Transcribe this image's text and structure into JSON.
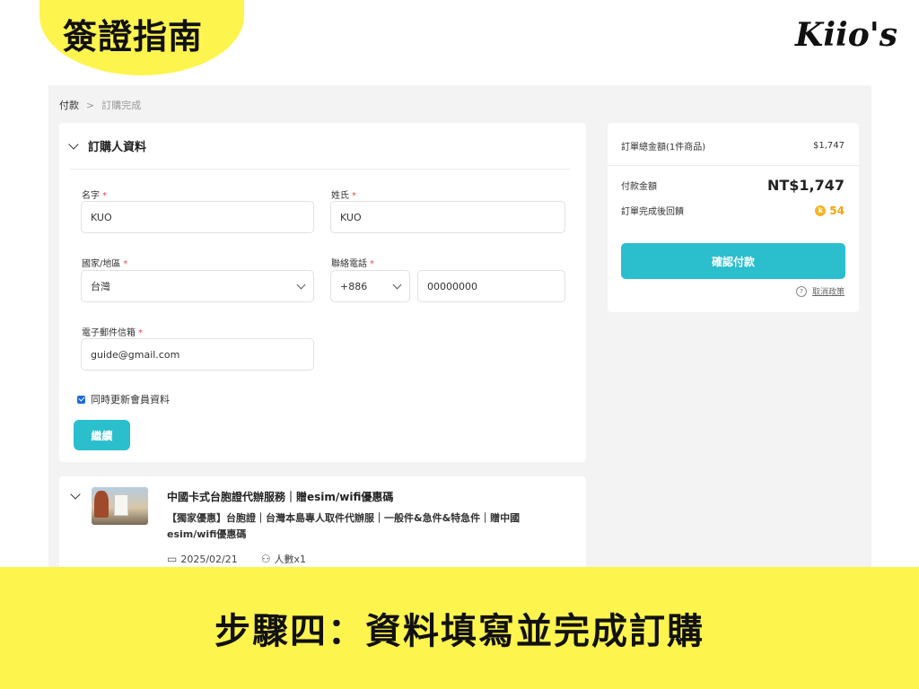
{
  "header": {
    "tag": "簽證指南",
    "brand": "Kiio's"
  },
  "breadcrumb": {
    "step1": "付款",
    "separator": ">",
    "step2": "訂購完成"
  },
  "orderer": {
    "section_title": "訂購人資料",
    "first_name_label": "名字",
    "first_name_value": "KUO",
    "last_name_label": "姓氏",
    "last_name_value": "KUO",
    "country_label": "國家/地區",
    "country_value": "台灣",
    "phone_label": "聯絡電話",
    "phone_code": "+886",
    "phone_value": "00000000",
    "email_label": "電子郵件信箱",
    "email_value": "guide@gmail.com",
    "required_mark": "*",
    "update_member_label": "同時更新會員資料",
    "update_member_checked": true,
    "continue_label": "繼續"
  },
  "product": {
    "title": "中國卡式台胞證代辦服務｜贈esim/wifi優惠碼",
    "description": "【獨家優惠】台胞證｜台灣本島專人取件代辦服｜一般件&急件&特急件｜贈中國esim/wifi優惠碼",
    "date": "2025/02/21",
    "people": "人數x1"
  },
  "summary": {
    "order_total_label": "訂單總金額(1件商品)",
    "order_total_value": "$1,747",
    "payment_label": "付款金額",
    "payment_value": "NT$1,747",
    "reward_label": "訂單完成後回饋",
    "reward_value": "54",
    "reward_coin": "k",
    "pay_button": "確認付款",
    "cancel_policy": "取消政策"
  },
  "footer": {
    "caption": "步驟四：資料填寫並完成訂購"
  },
  "colors": {
    "banner": "#fef44e",
    "accent": "#2bbecd",
    "required": "#e34d4d",
    "points": "#f2a20c"
  }
}
